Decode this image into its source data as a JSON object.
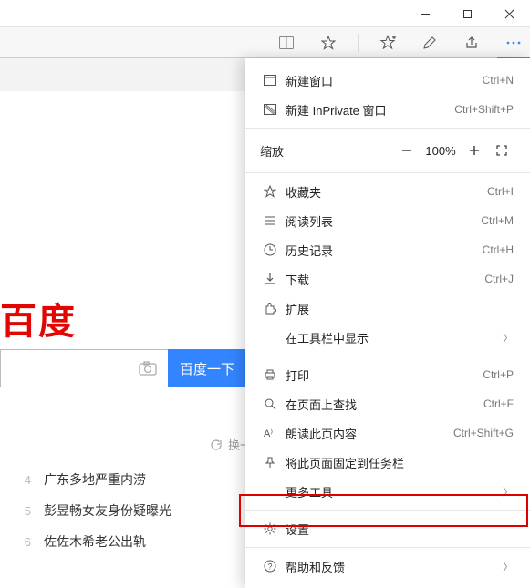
{
  "logo_text": "百度",
  "search_button": "百度一下",
  "refresh_label": "换一换",
  "news": [
    {
      "n": "4",
      "t": "广东多地严重内涝"
    },
    {
      "n": "5",
      "t": "彭昱畅女友身份疑曝光"
    },
    {
      "n": "6",
      "t": "佐佐木希老公出轨"
    }
  ],
  "menu": {
    "new_window": {
      "label": "新建窗口",
      "shortcut": "Ctrl+N"
    },
    "new_inprivate": {
      "label": "新建 InPrivate 窗口",
      "shortcut": "Ctrl+Shift+P"
    },
    "zoom_label": "缩放",
    "zoom_value": "100%",
    "favorites": {
      "label": "收藏夹",
      "shortcut": "Ctrl+I"
    },
    "reading_list": {
      "label": "阅读列表",
      "shortcut": "Ctrl+M"
    },
    "history": {
      "label": "历史记录",
      "shortcut": "Ctrl+H"
    },
    "downloads": {
      "label": "下载",
      "shortcut": "Ctrl+J"
    },
    "extensions": {
      "label": "扩展"
    },
    "show_in_toolbar": {
      "label": "在工具栏中显示"
    },
    "print": {
      "label": "打印",
      "shortcut": "Ctrl+P"
    },
    "find": {
      "label": "在页面上查找",
      "shortcut": "Ctrl+F"
    },
    "read_aloud": {
      "label": "朗读此页内容",
      "shortcut": "Ctrl+Shift+G"
    },
    "pin": {
      "label": "将此页面固定到任务栏"
    },
    "more_tools": {
      "label": "更多工具"
    },
    "settings": {
      "label": "设置"
    },
    "help": {
      "label": "帮助和反馈"
    }
  }
}
